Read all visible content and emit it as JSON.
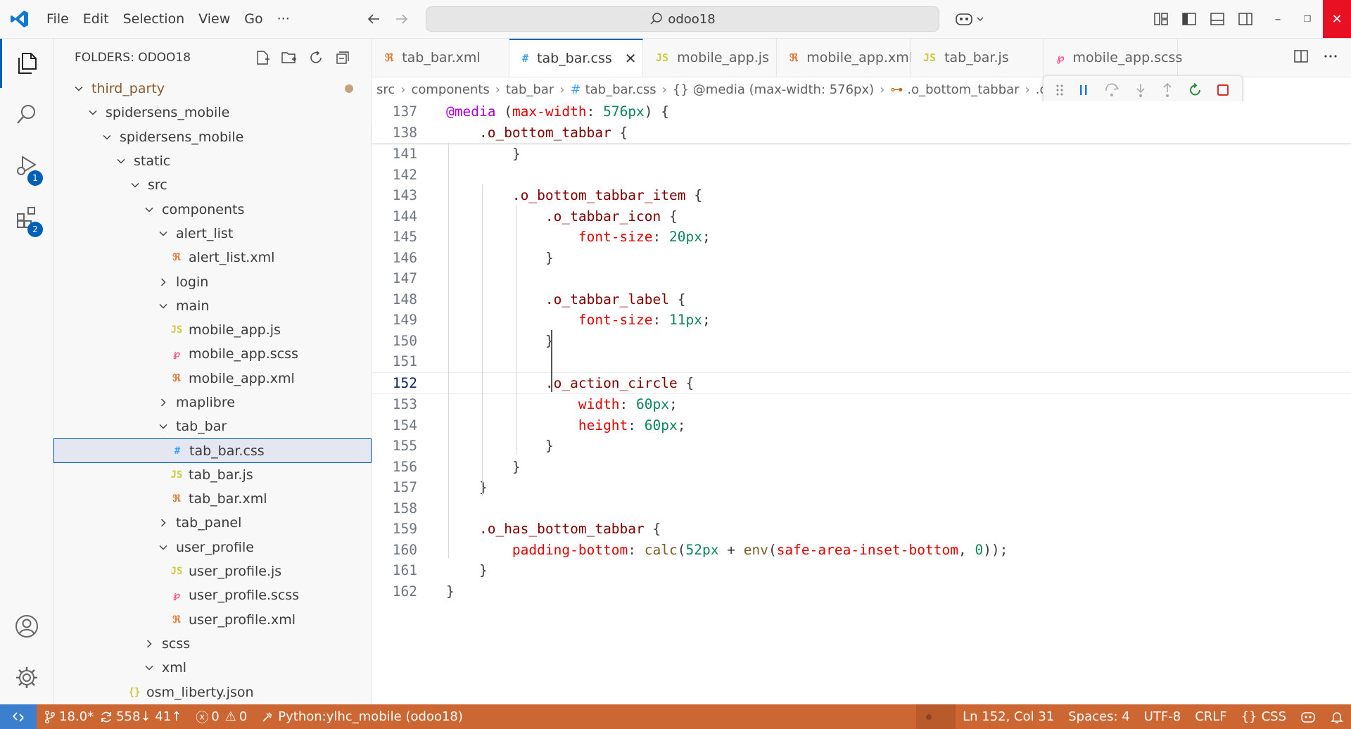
{
  "menu": [
    "File",
    "Edit",
    "Selection",
    "View",
    "Go",
    "···"
  ],
  "command_center": "odoo18",
  "sidebar": {
    "title": "FOLDERS: ODOO18",
    "tree": [
      {
        "label": "third_party",
        "kind": "folder-open",
        "indent": 0,
        "modified": true
      },
      {
        "label": "spidersens_mobile",
        "kind": "folder-open",
        "indent": 1
      },
      {
        "label": "spidersens_mobile",
        "kind": "folder-open",
        "indent": 2
      },
      {
        "label": "static",
        "kind": "folder-open",
        "indent": 3
      },
      {
        "label": "src",
        "kind": "folder-open",
        "indent": 4
      },
      {
        "label": "components",
        "kind": "folder-open",
        "indent": 5
      },
      {
        "label": "alert_list",
        "kind": "folder-open",
        "indent": 6
      },
      {
        "label": "alert_list.xml",
        "kind": "xml",
        "indent": 7
      },
      {
        "label": "login",
        "kind": "folder-closed",
        "indent": 6
      },
      {
        "label": "main",
        "kind": "folder-open",
        "indent": 6
      },
      {
        "label": "mobile_app.js",
        "kind": "js",
        "indent": 7
      },
      {
        "label": "mobile_app.scss",
        "kind": "scss",
        "indent": 7
      },
      {
        "label": "mobile_app.xml",
        "kind": "xml",
        "indent": 7
      },
      {
        "label": "maplibre",
        "kind": "folder-closed",
        "indent": 6
      },
      {
        "label": "tab_bar",
        "kind": "folder-open",
        "indent": 6
      },
      {
        "label": "tab_bar.css",
        "kind": "css",
        "indent": 7,
        "selected": true
      },
      {
        "label": "tab_bar.js",
        "kind": "js",
        "indent": 7
      },
      {
        "label": "tab_bar.xml",
        "kind": "xml",
        "indent": 7
      },
      {
        "label": "tab_panel",
        "kind": "folder-closed",
        "indent": 6
      },
      {
        "label": "user_profile",
        "kind": "folder-open",
        "indent": 6
      },
      {
        "label": "user_profile.js",
        "kind": "js",
        "indent": 7
      },
      {
        "label": "user_profile.scss",
        "kind": "scss",
        "indent": 7
      },
      {
        "label": "user_profile.xml",
        "kind": "xml",
        "indent": 7
      },
      {
        "label": "scss",
        "kind": "folder-closed",
        "indent": 5
      },
      {
        "label": "xml",
        "kind": "folder-open",
        "indent": 5
      },
      {
        "label": "osm_liberty.json",
        "kind": "json",
        "indent": 4
      }
    ]
  },
  "tabs": [
    {
      "label": "tab_bar.xml",
      "kind": "xml"
    },
    {
      "label": "tab_bar.css",
      "kind": "css",
      "active": true
    },
    {
      "label": "mobile_app.js",
      "kind": "js"
    },
    {
      "label": "mobile_app.xml",
      "kind": "xml"
    },
    {
      "label": "tab_bar.js",
      "kind": "js"
    },
    {
      "label": "mobile_app.scss",
      "kind": "scss"
    }
  ],
  "breadcrumb": [
    "src",
    "components",
    "tab_bar",
    "tab_bar.css",
    "@media (max-width: 576px)",
    ".o_bottom_tabbar",
    ".o_action_circle"
  ],
  "code": [
    {
      "n": "137",
      "t": "@media (max-width: 576px) {",
      "sticky": true
    },
    {
      "n": "138",
      "t": "    .o_bottom_tabbar {",
      "sticky": true
    },
    {
      "n": "141",
      "t": "        }"
    },
    {
      "n": "142",
      "t": ""
    },
    {
      "n": "143",
      "t": "        .o_bottom_tabbar_item {"
    },
    {
      "n": "144",
      "t": "            .o_tabbar_icon {"
    },
    {
      "n": "145",
      "t": "                font-size: 20px;"
    },
    {
      "n": "146",
      "t": "            }"
    },
    {
      "n": "147",
      "t": ""
    },
    {
      "n": "148",
      "t": "            .o_tabbar_label {"
    },
    {
      "n": "149",
      "t": "                font-size: 11px;"
    },
    {
      "n": "150",
      "t": "            }"
    },
    {
      "n": "151",
      "t": ""
    },
    {
      "n": "152",
      "t": "            .o_action_circle {",
      "current": true
    },
    {
      "n": "153",
      "t": "                width: 60px;"
    },
    {
      "n": "154",
      "t": "                height: 60px;"
    },
    {
      "n": "155",
      "t": "            }"
    },
    {
      "n": "156",
      "t": "        }"
    },
    {
      "n": "157",
      "t": "    }"
    },
    {
      "n": "158",
      "t": ""
    },
    {
      "n": "159",
      "t": "    .o_has_bottom_tabbar {"
    },
    {
      "n": "160",
      "t": "        padding-bottom: calc(52px + env(safe-area-inset-bottom, 0));"
    },
    {
      "n": "161",
      "t": "    }"
    },
    {
      "n": "162",
      "t": "}"
    }
  ],
  "status": {
    "branch": "18.0*",
    "sync": "558↓ 41↑",
    "errors": "0",
    "warnings": "0",
    "interpreter": "Python:ylhc_mobile (odoo18)",
    "position": "Ln 152, Col 31",
    "spaces": "Spaces: 4",
    "encoding": "UTF-8",
    "eol": "CRLF",
    "language": "CSS"
  },
  "badges": {
    "debug": "1",
    "extensions": "2"
  },
  "colors": {
    "accent": "#005fb8",
    "statusbar": "#cc6633",
    "remote": "#3c7fcf",
    "close": "#e81123"
  }
}
